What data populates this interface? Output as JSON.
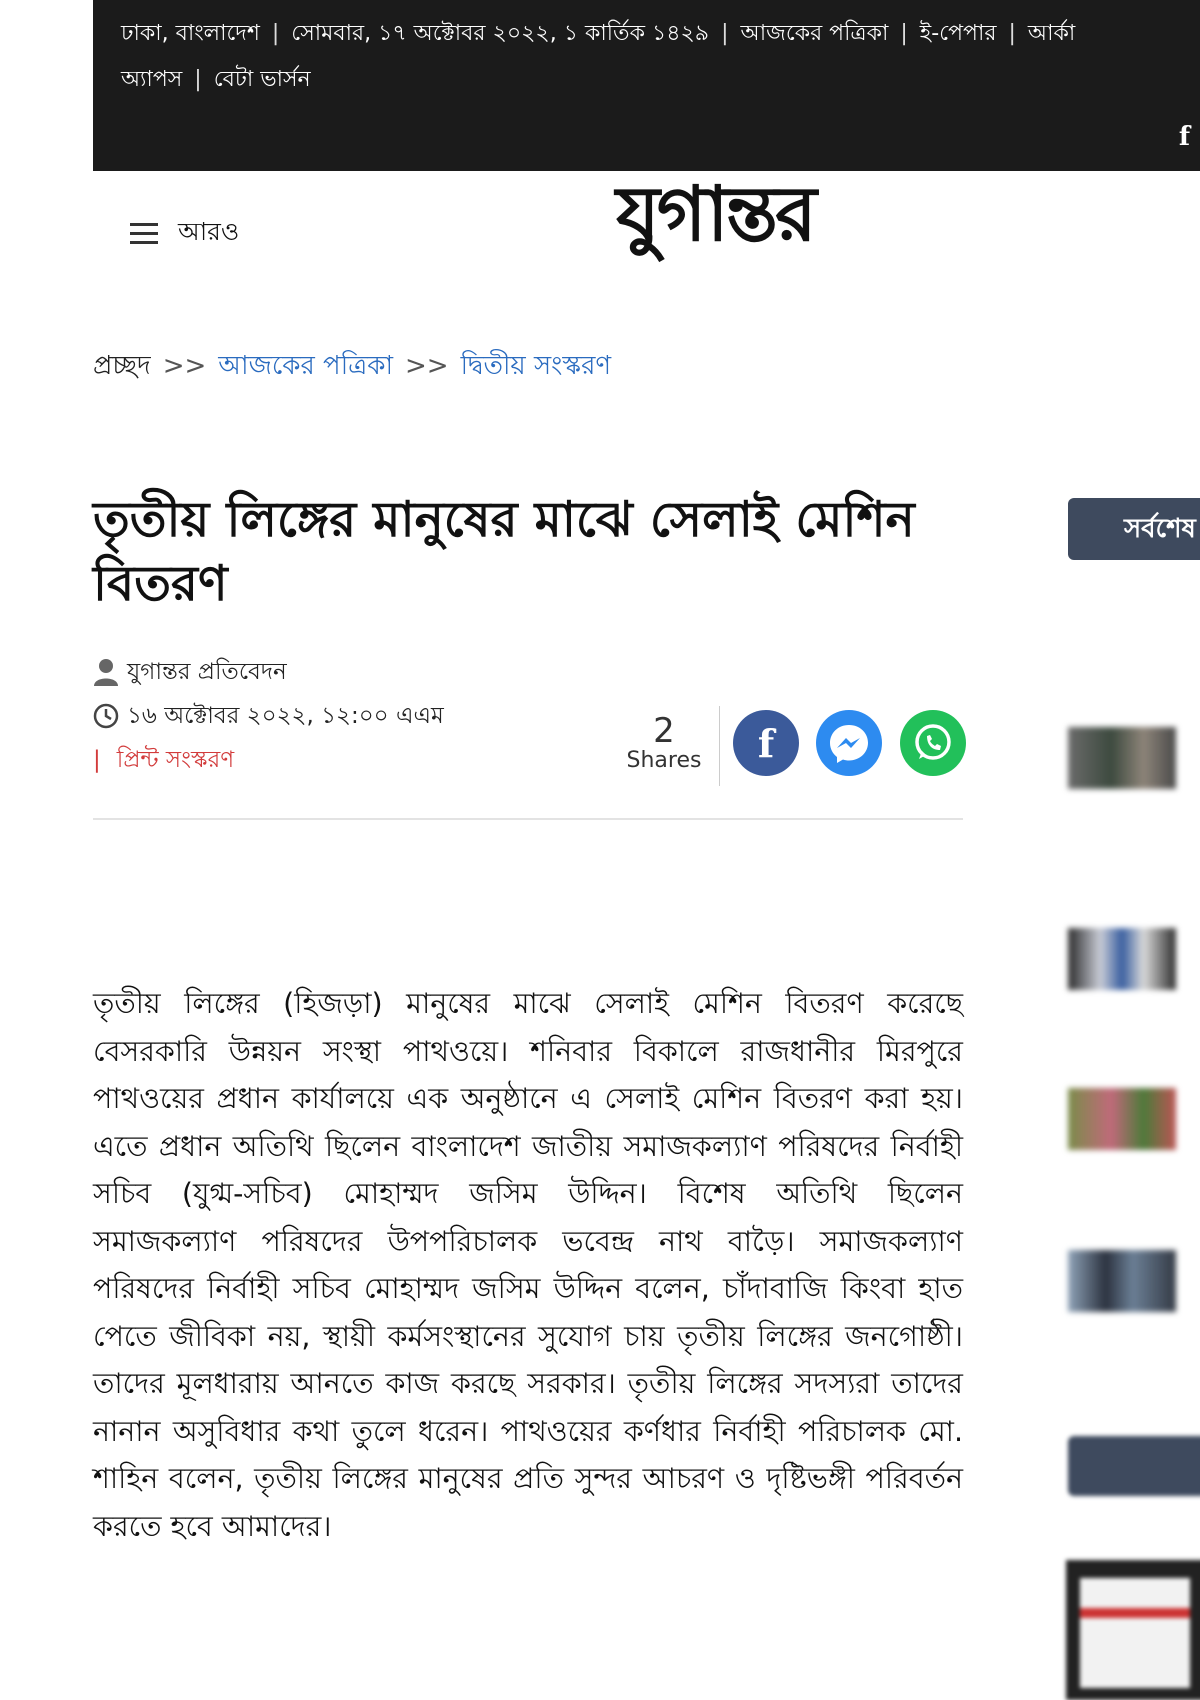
{
  "topbar": {
    "location": "ঢাকা, বাংলাদেশ",
    "date": "সোমবার, ১৭ অক্টোবর ২০২২, ১ কার্তিক ১৪২৯",
    "links": [
      "আজকের পত্রিকা",
      "ই-পেপার",
      "আর্কা"
    ],
    "row2": [
      "অ্যাপস",
      "বেটা ভার্সন"
    ],
    "social_icon": "facebook-icon"
  },
  "header": {
    "menu_label": "আরও",
    "logo_text": "যুগান্তর"
  },
  "breadcrumb": {
    "home": "প্রচ্ছদ",
    "separator": ">>",
    "items": [
      "আজকের পত্রিকা",
      "দ্বিতীয় সংস্করণ"
    ]
  },
  "article": {
    "title": "তৃতীয় লিঙ্গের মানুষের মাঝে সেলাই মেশিন বিতরণ",
    "author": "যুগান্তর প্রতিবেদন",
    "published": "১৬ অক্টোবর ২০২২, ১২:০০ এএম",
    "print_separator": "|",
    "print_edition": "প্রিন্ট সংস্করণ",
    "share_count": "2",
    "share_label": "Shares",
    "body": "তৃতীয় লিঙ্গের (হিজড়া) মানুষের মাঝে সেলাই মেশিন বিতরণ করেছে বেসরকারি উন্নয়ন সংস্থা পাথওয়ে। শনিবার বিকালে রাজধানীর মিরপুরে পাথওয়ের প্রধান কার্যালয়ে এক অনুষ্ঠানে এ সেলাই মেশিন বিতরণ করা হয়। এতে প্রধান অতিথি ছিলেন বাংলাদেশ জাতীয় সমাজকল্যাণ পরিষদের নির্বাহী সচিব (যুগ্ম-সচিব) মোহাম্মদ জসিম উদ্দিন। বিশেষ অতিথি ছিলেন সমাজকল্যাণ পরিষদের উপপরিচালক ভবেন্দ্র নাথ বাড়ৈ। সমাজকল্যাণ পরিষদের নির্বাহী সচিব মোহাম্মদ জসিম উদ্দিন বলেন, চাঁদাবাজি কিংবা হাত পেতে জীবিকা নয়, স্থায়ী কর্মসংস্থানের সুযোগ চায় তৃতীয় লিঙ্গের জনগোষ্ঠী। তাদের মূলধারায় আনতে কাজ করছে সরকার। তৃতীয় লিঙ্গের সদস্যরা তাদের নানান অসুবিধার কথা তুলে ধরেন। পাথওয়ের কর্ণধার নির্বাহী পরিচালক মো. শাহিন বলেন, তৃতীয় লিঙ্গের মানুষের প্রতি সুন্দর আচরণ ও দৃষ্টিভঙ্গী পরিবর্তন করতে হবে আমাদের।"
  },
  "sidebar": {
    "heading": "সর্বশেষ"
  },
  "colors": {
    "topbar": "#1b1b1b",
    "link_blue": "#2a6bbf",
    "print_red": "#d23b3b",
    "facebook": "#3b5a9a",
    "messenger": "#2d8bf0",
    "whatsapp": "#22c05a",
    "sidebar_head": "#3e4a5e"
  }
}
